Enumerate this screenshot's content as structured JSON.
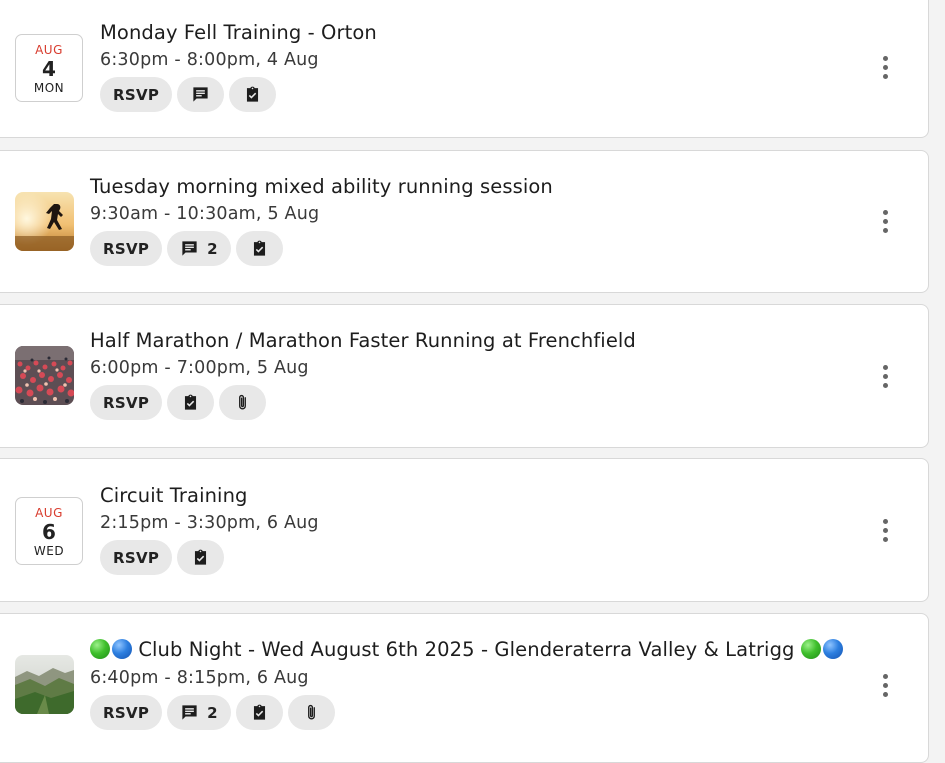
{
  "events": [
    {
      "title": "Monday Fell Training - Orton",
      "time": "6:30pm - 8:00pm, 4 Aug",
      "date": {
        "month": "AUG",
        "day": "4",
        "weekday": "MON"
      },
      "chips": {
        "rsvp": "RSVP"
      }
    },
    {
      "title": "Tuesday morning mixed ability running session",
      "time": "9:30am - 10:30am, 5 Aug",
      "chips": {
        "rsvp": "RSVP",
        "comments": "2"
      }
    },
    {
      "title": "Half Marathon / Marathon Faster Running at Frenchfield",
      "time": "6:00pm - 7:00pm, 5 Aug",
      "chips": {
        "rsvp": "RSVP"
      }
    },
    {
      "title": "Circuit Training",
      "time": "2:15pm - 3:30pm, 6 Aug",
      "date": {
        "month": "AUG",
        "day": "6",
        "weekday": "WED"
      },
      "chips": {
        "rsvp": "RSVP"
      }
    },
    {
      "title": "Club Night - Wed August 6th 2025 - Glenderaterra Valley & Latrigg",
      "time": "6:40pm - 8:15pm, 6 Aug",
      "chips": {
        "rsvp": "RSVP",
        "comments": "2"
      }
    }
  ],
  "icons": {
    "comment": "comment-icon",
    "task": "checklist-icon",
    "attachment": "paperclip-icon",
    "more": "more-vertical-icon",
    "green_circle": "green-circle-emoji",
    "blue_circle": "blue-circle-emoji"
  },
  "colors": {
    "month_red": "#d83b2d",
    "chip_bg": "#e8e8e8",
    "green_emoji": "#3fbf2c",
    "blue_emoji": "#2d7fe0"
  }
}
